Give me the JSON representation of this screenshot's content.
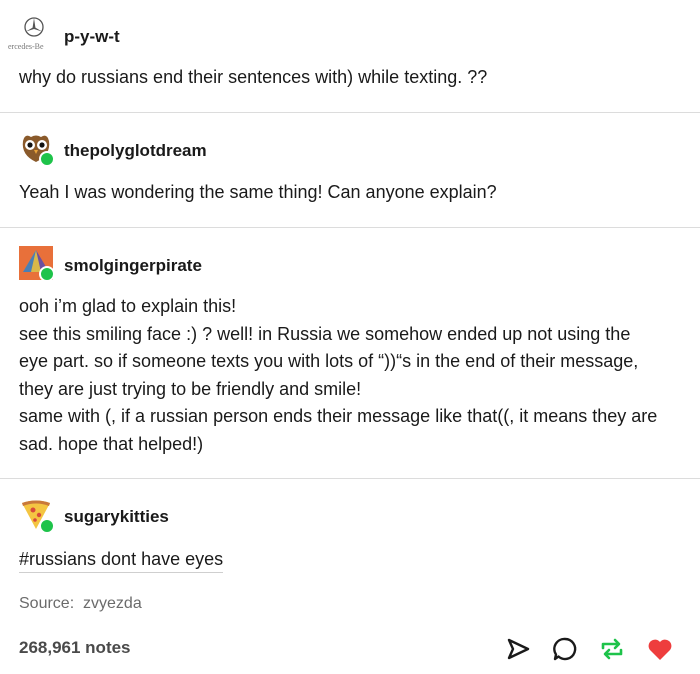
{
  "posts": [
    {
      "username": "p-y-w-t",
      "avatar_caption": "ercedes-Be",
      "avatar_icon": "mercedes-logo-icon",
      "lines": [
        "why do russians end their sentences with) while texting. ??"
      ]
    },
    {
      "username": "thepolyglotdream",
      "avatar_icon": "owl-avatar-icon",
      "lines": [
        "Yeah I was wondering the same thing! Can anyone explain?"
      ]
    },
    {
      "username": "smolgingerpirate",
      "avatar_icon": "geometric-avatar-icon",
      "lines": [
        "ooh i’m glad to explain this!",
        "see this smiling face :) ? well! in Russia we somehow ended up not using the",
        "eye part. so if someone texts you with lots of “))“s in the end of their message,",
        "they are just trying to be friendly and smile!",
        "same with (, if a russian person ends their message like that((, it means they are",
        "sad. hope that helped!)"
      ]
    },
    {
      "username": "sugarykitties",
      "avatar_icon": "pizza-avatar-icon",
      "tag": "#russians dont have eyes"
    }
  ],
  "source": {
    "label": "Source:",
    "name": "zvyezda"
  },
  "notes": "268,961 notes",
  "actions": [
    "share-icon",
    "reply-icon",
    "reblog-icon",
    "like-icon"
  ],
  "colors": {
    "reblog": "#1ec34a",
    "like": "#ee3d3d",
    "divider": "#dcdcdc"
  }
}
